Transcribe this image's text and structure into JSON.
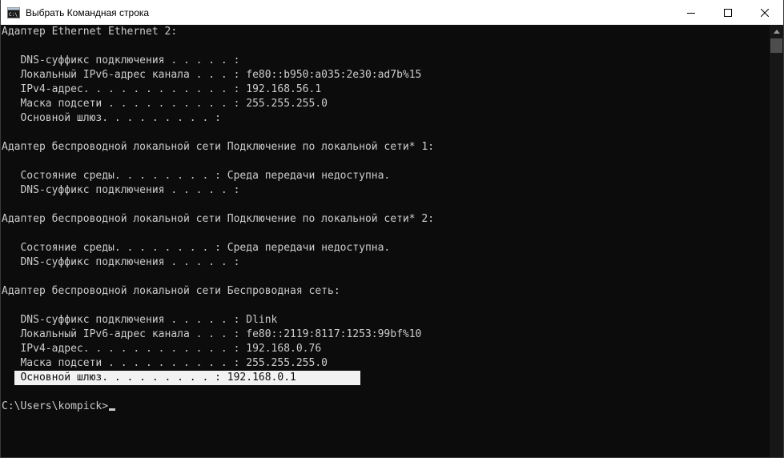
{
  "window": {
    "title": "Выбрать Командная строка",
    "minimize_icon": "minimize-icon",
    "maximize_icon": "maximize-icon",
    "close_icon": "close-icon"
  },
  "console": {
    "lines": [
      "Адаптер Ethernet Ethernet 2:",
      "",
      "   DNS-суффикс подключения . . . . . :",
      "   Локальный IPv6-адрес канала . . . : fe80::b950:a035:2e30:ad7b%15",
      "   IPv4-адрес. . . . . . . . . . . . : 192.168.56.1",
      "   Маска подсети . . . . . . . . . . : 255.255.255.0",
      "   Основной шлюз. . . . . . . . . :",
      "",
      "Адаптер беспроводной локальной сети Подключение по локальной сети* 1:",
      "",
      "   Состояние среды. . . . . . . . : Среда передачи недоступна.",
      "   DNS-суффикс подключения . . . . . :",
      "",
      "Адаптер беспроводной локальной сети Подключение по локальной сети* 2:",
      "",
      "   Состояние среды. . . . . . . . : Среда передачи недоступна.",
      "   DNS-суффикс подключения . . . . . :",
      "",
      "Адаптер беспроводной локальной сети Беспроводная сеть:",
      "",
      "   DNS-суффикс подключения . . . . . : Dlink",
      "   Локальный IPv6-адрес канала . . . : fe80::2119:8117:1253:99bf%10",
      "   IPv4-адрес. . . . . . . . . . . . : 192.168.0.76",
      "   Маска подсети . . . . . . . . . . : 255.255.255.0",
      "   Основной шлюз. . . . . . . . . : 192.168.0.1",
      "",
      "C:\\Users\\kompick>"
    ],
    "selected_line_index": 24
  },
  "colors": {
    "background": "#0c0c0c",
    "text": "#cccccc",
    "selection": "#f2f2f2"
  }
}
